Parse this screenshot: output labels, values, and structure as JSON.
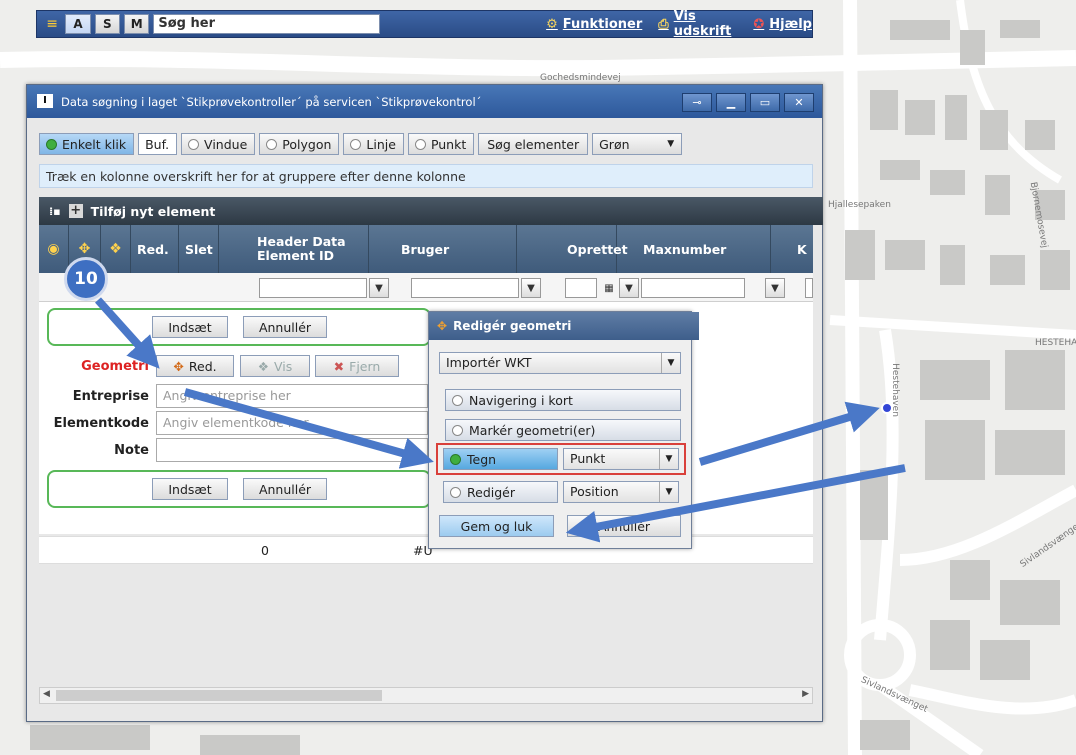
{
  "map": {
    "street_labels": [
      "Gochedsmindevej",
      "Hjallesepaken",
      "Bjornemosevej",
      "HESTEHA",
      "Hestehaven",
      "Sivlandsvænget",
      "Sivlandsvænget"
    ]
  },
  "toolbar": {
    "mode_buttons": [
      "A",
      "S",
      "M"
    ],
    "search_value": "Søg her",
    "functions_label": "Funktioner",
    "print_label": "Vis udskrift",
    "help_label": "Hjælp"
  },
  "dialog": {
    "title": "Data søgning i laget `Stikprøvekontroller´ på servicen `Stikprøvekontrol´",
    "selection": {
      "single_click": "Enkelt klik",
      "buffer": "Buf.",
      "window": "Vindue",
      "polygon": "Polygon",
      "line": "Linje",
      "point": "Punkt",
      "search_elements": "Søg elementer",
      "color": "Grøn"
    },
    "group_hint": "Træk en kolonne overskrift her for at gruppere efter denne kolonne",
    "add_element": "Tilføj nyt element",
    "columns": {
      "edit": "Red.",
      "delete": "Slet",
      "header_id": "Header Data Element ID",
      "user": "Bruger",
      "created": "Oprettet",
      "maxnumber": "Maxnumber",
      "k": "K"
    },
    "form": {
      "insert": "Indsæt",
      "cancel": "Annullér",
      "geometry_label": "Geometri",
      "geom_edit": "Red.",
      "geom_show": "Vis",
      "geom_remove": "Fjern",
      "entreprise_label": "Entreprise",
      "entreprise_placeholder": "Angiv entreprise her",
      "elementcode_label": "Elementkode",
      "elementcode_placeholder": "Angiv elementkode her",
      "note_label": "Note"
    },
    "data_row": {
      "header_id": "0",
      "user_fragment": "#U"
    }
  },
  "geometry_popup": {
    "title": "Redigér geometri",
    "import_select": "Importér WKT",
    "navigate": "Navigering i kort",
    "select_geom": "Markér geometri(er)",
    "draw": "Tegn",
    "draw_type": "Punkt",
    "edit": "Redigér",
    "edit_type": "Position",
    "save_close": "Gem og luk",
    "cancel": "Annullér"
  },
  "step_badge": "10",
  "colors": {
    "toolbar_blue": "#2f5592",
    "highlight_red": "#d9403b",
    "arrow_blue": "#4a78c8",
    "group_green": "#58b858"
  },
  "icons": [
    "layers-icon",
    "gear-icon",
    "print-icon",
    "help-lifebuoy-icon",
    "geometry-edit-icon",
    "pin-icon",
    "restore-icon",
    "minimize-icon",
    "maximize-icon",
    "close-icon"
  ]
}
